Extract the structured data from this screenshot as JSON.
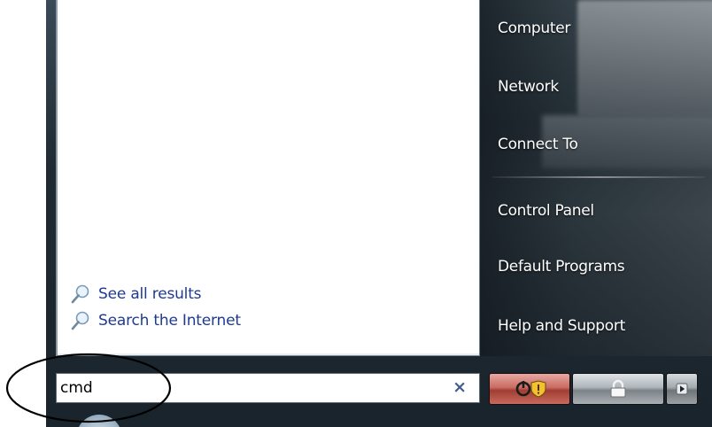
{
  "right_pane": {
    "items": [
      {
        "label": "Computer"
      },
      {
        "label": "Network"
      },
      {
        "label": "Connect To"
      },
      {
        "label": "Control Panel"
      },
      {
        "label": "Default Programs"
      },
      {
        "label": "Help and Support"
      }
    ]
  },
  "left_pane": {
    "results": [
      {
        "label": "See all results",
        "icon": "search-icon"
      },
      {
        "label": "Search the Internet",
        "icon": "search-icon"
      }
    ]
  },
  "search": {
    "value": "cmd",
    "clear_symbol": "×"
  },
  "power": {
    "shutdown_icon": "power-shield-icon",
    "lock_icon": "lock-icon",
    "more_icon": "arrow-right-icon"
  },
  "colors": {
    "link": "#1f3a93",
    "power_button": "#c86c62",
    "menu_dark": "#1f2a33"
  }
}
